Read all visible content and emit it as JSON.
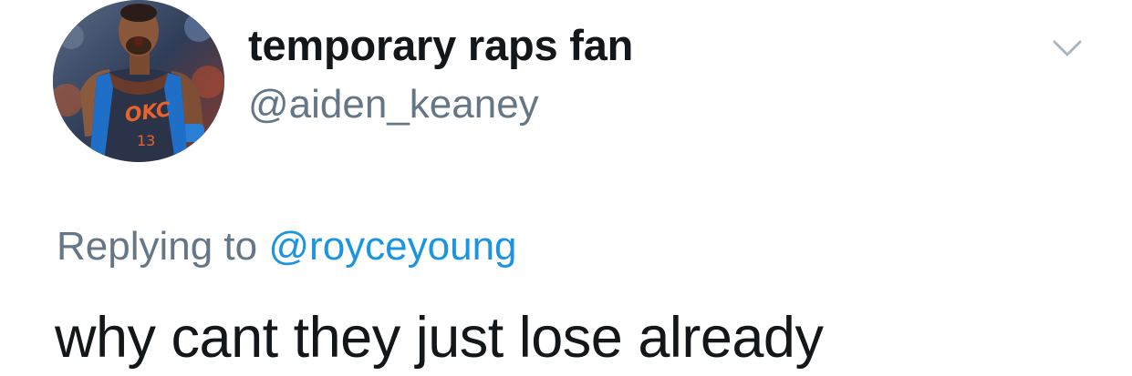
{
  "author": {
    "display_name": "temporary raps fan",
    "handle": "@aiden_keaney",
    "avatar": {
      "icon": "profile-photo-basketball-player",
      "jersey_text": "OKC",
      "jersey_number": "13"
    }
  },
  "reply": {
    "prefix": "Replying to",
    "mention": "@royceyoung"
  },
  "tweet": {
    "text": "why cant they just lose already"
  },
  "menu": {
    "icon": "chevron-down-icon"
  },
  "colors": {
    "text_primary": "#14171a",
    "text_secondary": "#657786",
    "link": "#1b95e0",
    "background": "#ffffff"
  }
}
